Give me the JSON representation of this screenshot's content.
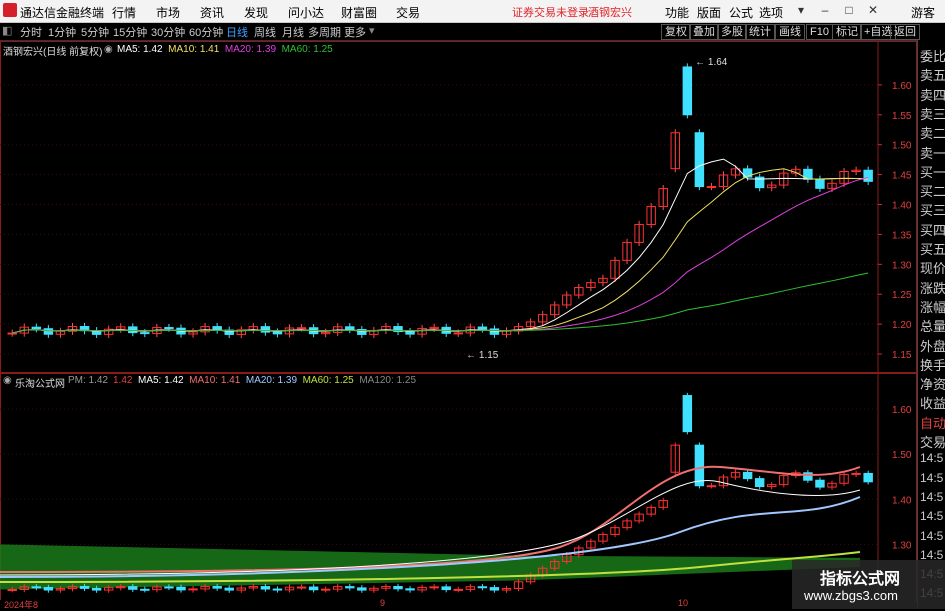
{
  "topbar": {
    "app_title": "通达信金融终端",
    "menus": [
      "行情",
      "市场",
      "资讯",
      "发现",
      "问小达",
      "财富圈",
      "交易"
    ],
    "warning": "证券交易未登录",
    "stock_tag": "酒钢宏兴",
    "right_menus": [
      "功能",
      "版面",
      "公式",
      "选项"
    ],
    "guest": "游客"
  },
  "periods": [
    "分时",
    "1分钟",
    "5分钟",
    "15分钟",
    "30分钟",
    "60分钟",
    "日线",
    "周线",
    "月线",
    "多周期",
    "更多"
  ],
  "active_period": "日线",
  "tools": [
    "复权",
    "叠加",
    "多股",
    "统计",
    "画线",
    "F10",
    "标记",
    "+自选",
    "返回"
  ],
  "main_chart": {
    "title": "酒钢宏兴(日线 前复权)",
    "ma_labels": [
      "MA5: 1.42",
      "MA10: 1.41",
      "MA20: 1.39",
      "MA60: 1.25"
    ],
    "ma_colors": [
      "#ffffff",
      "#f0e060",
      "#e040e0",
      "#30c030"
    ],
    "y_ticks": [
      "1.60",
      "1.55",
      "1.50",
      "1.45",
      "1.40",
      "1.35",
      "1.30",
      "1.25",
      "1.20",
      "1.15"
    ],
    "high_label": "1.64",
    "low_label": "1.15"
  },
  "sub_chart": {
    "title": "乐淘公式网",
    "pm_label": "PM: 1.42",
    "pm_value": "1.42",
    "ma_labels": [
      "MA5: 1.42",
      "MA10: 1.41",
      "MA20: 1.39",
      "MA60: 1.25",
      "MA120: 1.25"
    ],
    "ma_colors": [
      "#ffffff",
      "#f07070",
      "#a0c8ff",
      "#c0e040",
      "#888888"
    ],
    "y_ticks": [
      "1.60",
      "1.50",
      "1.40",
      "1.30"
    ]
  },
  "x_labels": [
    "2024年8",
    "9",
    "10"
  ],
  "right_panel": {
    "items": [
      "委比",
      "卖五",
      "卖四",
      "卖三",
      "卖二",
      "卖一",
      "买一",
      "买二",
      "买三",
      "买四",
      "买五",
      "现价",
      "涨跌",
      "涨幅",
      "总量",
      "外盘",
      "换手",
      "净资",
      "收益",
      "自动",
      "交易",
      "14:5",
      "14:5",
      "14:5",
      "14:5",
      "14:5",
      "14:5",
      "14:5",
      "14:5"
    ]
  },
  "watermark": {
    "line1": "指标公式网",
    "line2": "www.zbgs3.com"
  }
}
